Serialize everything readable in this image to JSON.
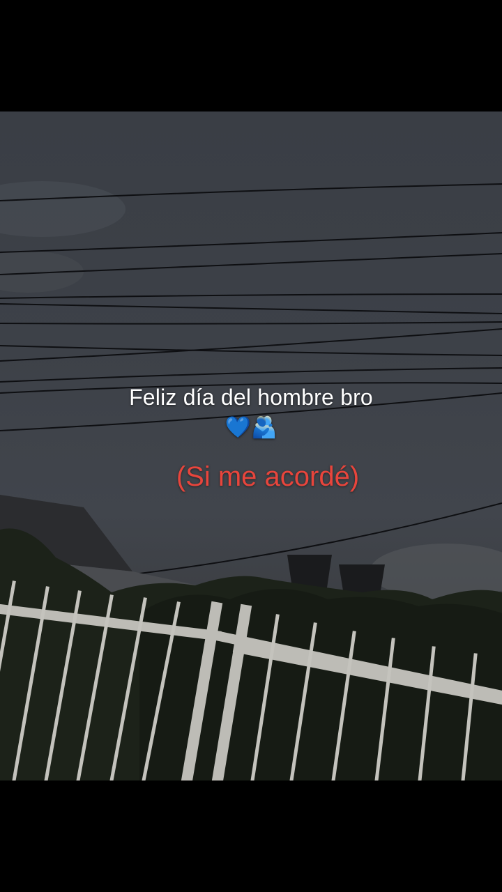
{
  "caption": {
    "line1": "Feliz día del hombre bro",
    "emoji": "💙🫂",
    "line2": "(Si me acordé)"
  },
  "colors": {
    "caption_main": "#ffffff",
    "caption_sub": "#e8453c",
    "letterbox": "#000000"
  }
}
